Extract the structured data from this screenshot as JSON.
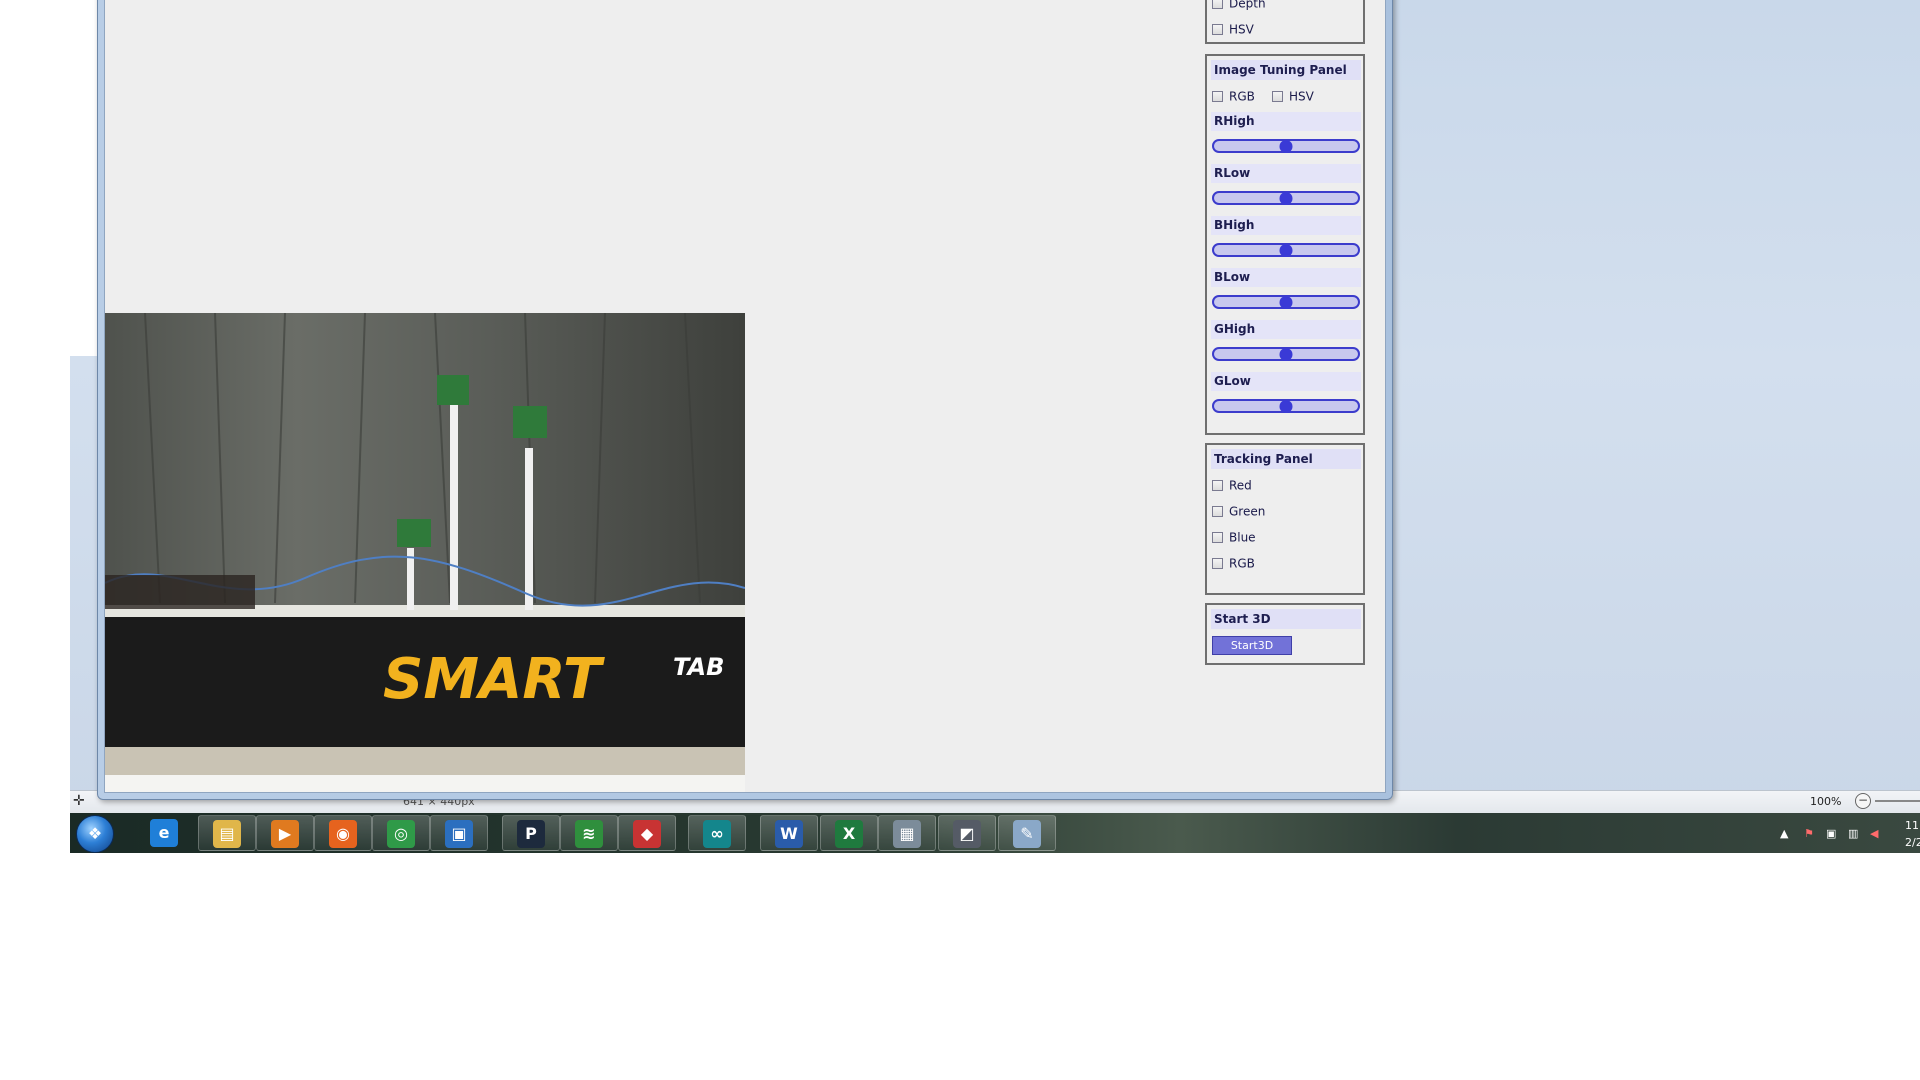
{
  "background_app": {
    "status_dims": "641 × 440px",
    "zoom_level": "100%"
  },
  "panels": {
    "color_panel": {
      "checkboxes": [
        {
          "label": "Depth",
          "checked": false
        },
        {
          "label": "HSV",
          "checked": false
        }
      ]
    },
    "image_tuning": {
      "title": "Image Tuning Panel",
      "modes": [
        {
          "label": "RGB",
          "checked": false
        },
        {
          "label": "HSV",
          "checked": false
        }
      ],
      "sliders": [
        {
          "label": "RHigh",
          "value": 0.5
        },
        {
          "label": "RLow",
          "value": 0.5
        },
        {
          "label": "BHigh",
          "value": 0.5
        },
        {
          "label": "BLow",
          "value": 0.5
        },
        {
          "label": "GHigh",
          "value": 0.5
        },
        {
          "label": "GLow",
          "value": 0.5
        }
      ]
    },
    "tracking": {
      "title": "Tracking Panel",
      "checkboxes": [
        {
          "label": "Red",
          "checked": false
        },
        {
          "label": "Green",
          "checked": false
        },
        {
          "label": "Blue",
          "checked": false
        },
        {
          "label": "RGB",
          "checked": false
        }
      ]
    },
    "start3d": {
      "title": "Start 3D",
      "button_label": "Start3D"
    }
  },
  "camera_feed": {
    "banner_text": "SMART",
    "banner_suffix": "TAB"
  },
  "taskbar": {
    "apps": [
      {
        "name": "internet-explorer-icon",
        "glyph": "e",
        "color": "#1f7fd8"
      },
      {
        "name": "file-explorer-icon",
        "glyph": "▤",
        "color": "#e0b64a"
      },
      {
        "name": "media-player-icon",
        "glyph": "▶",
        "color": "#e07a1f"
      },
      {
        "name": "firefox-icon",
        "glyph": "◉",
        "color": "#e6631e"
      },
      {
        "name": "chrome-icon",
        "glyph": "◎",
        "color": "#2f9a48"
      },
      {
        "name": "window-app-icon",
        "glyph": "▣",
        "color": "#2b6fbf"
      },
      {
        "name": "pandora-icon",
        "glyph": "P",
        "color": "#1d2a3d"
      },
      {
        "name": "green-app-icon",
        "glyph": "≋",
        "color": "#2f8f3d"
      },
      {
        "name": "red-app-icon",
        "glyph": "◆",
        "color": "#c83333"
      },
      {
        "name": "arduino-icon",
        "glyph": "∞",
        "color": "#14868c"
      },
      {
        "name": "word-icon",
        "glyph": "W",
        "color": "#2a5caa"
      },
      {
        "name": "excel-icon",
        "glyph": "X",
        "color": "#1f7a3e"
      },
      {
        "name": "calculator-icon",
        "glyph": "▦",
        "color": "#7c8c9a"
      },
      {
        "name": "java-app-icon",
        "glyph": "◩",
        "color": "#555b66"
      },
      {
        "name": "paint-icon",
        "glyph": "✎",
        "color": "#8aa8c8"
      }
    ],
    "clock_time": "11",
    "clock_date": "2/2"
  }
}
